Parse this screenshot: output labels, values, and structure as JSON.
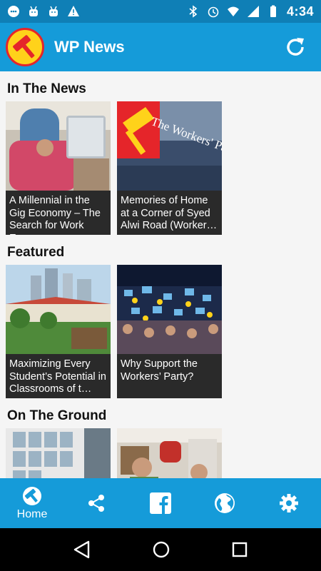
{
  "status": {
    "time": "4:34",
    "left_icons": [
      "chat-notification-icon",
      "android-icon",
      "android-icon",
      "warning-icon"
    ],
    "right_icons": [
      "bluetooth-icon",
      "alarm-icon",
      "wifi-icon",
      "signal-icon",
      "battery-icon"
    ]
  },
  "app_bar": {
    "title": "WP News",
    "logo_icon": "hammer-logo-icon",
    "refresh_icon": "refresh-icon"
  },
  "sections": [
    {
      "title": "In The News",
      "cards": [
        {
          "caption": "A Millennial in the Gig Economy – The Search for Work Ex…"
        },
        {
          "caption": "Memories of Home at a Corner of Syed Alwi Road (Worker…"
        }
      ]
    },
    {
      "title": "Featured",
      "cards": [
        {
          "caption": "Maximizing Every Student’s Potential in Classrooms of t…"
        },
        {
          "caption": "Why Support the Workers’ Party?"
        }
      ]
    },
    {
      "title": "On The Ground",
      "cards": [
        {
          "caption": ""
        },
        {
          "caption": ""
        }
      ]
    }
  ],
  "bottom_nav": {
    "home_label": "Home",
    "items": [
      "home-icon",
      "share-icon",
      "facebook-icon",
      "globe-icon",
      "settings-icon"
    ]
  },
  "colors": {
    "status_bar": "#0f7fb6",
    "app_bar": "#159bd9",
    "caption_bg": "#2a2a2a"
  }
}
